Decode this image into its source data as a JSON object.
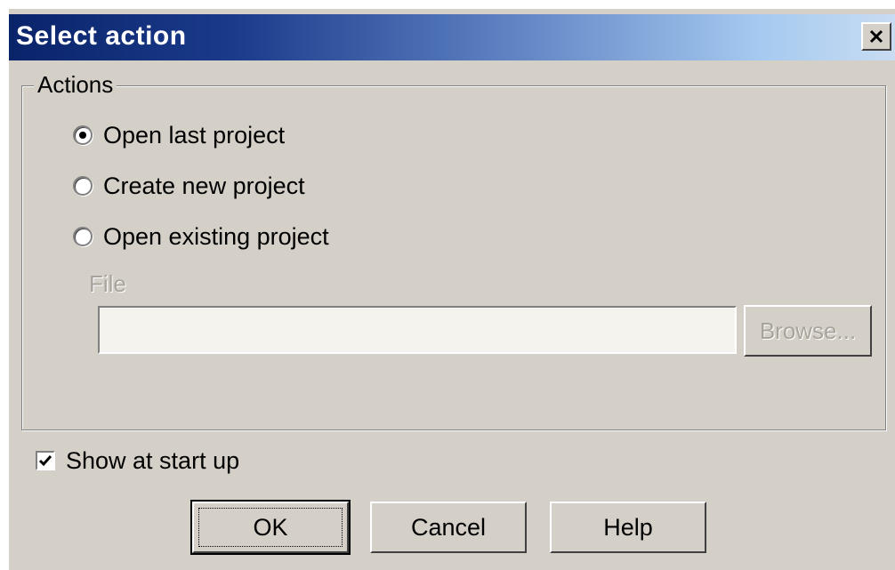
{
  "dialog": {
    "title": "Select action",
    "close_label": "X"
  },
  "actions_group": {
    "legend": "Actions",
    "options": [
      {
        "label": "Open last project",
        "selected": true
      },
      {
        "label": "Create new project",
        "selected": false
      },
      {
        "label": "Open existing project",
        "selected": false
      }
    ],
    "file_label": "File",
    "file_value": "",
    "browse_label": "Browse..."
  },
  "show_at_startup": {
    "label": "Show at start up",
    "checked": true
  },
  "buttons": {
    "ok_label": "OK",
    "cancel_label": "Cancel",
    "help_label": "Help"
  },
  "colors": {
    "title_start": "#0a246a",
    "title_end": "#a6caf0",
    "face": "#d4d0c8",
    "disabled_text": "#a8a49c"
  },
  "icons": {
    "close": "close-icon",
    "check": "check-icon"
  }
}
